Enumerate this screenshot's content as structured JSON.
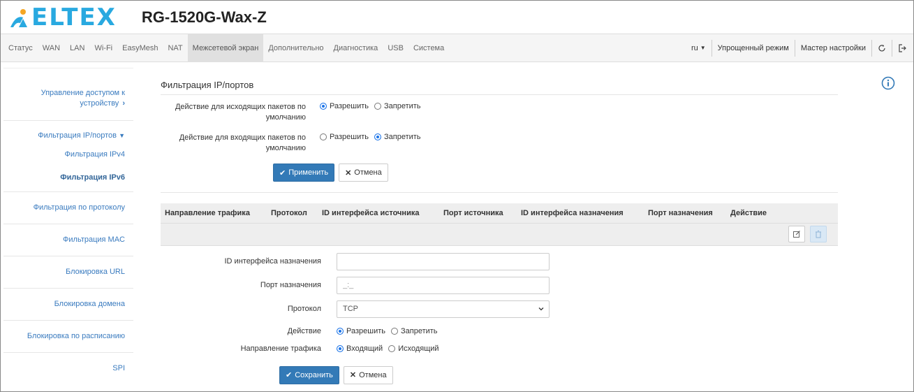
{
  "header": {
    "brand": "ELTEX",
    "model": "RG-1520G-Wax-Z"
  },
  "nav": {
    "items": [
      "Статус",
      "WAN",
      "LAN",
      "Wi-Fi",
      "EasyMesh",
      "NAT",
      "Межсетевой экран",
      "Дополнительно",
      "Диагностика",
      "USB",
      "Система"
    ],
    "active": "Межсетевой экран",
    "language": "ru",
    "simple_mode": "Упрощенный режим",
    "wizard": "Мастер настройки"
  },
  "sidebar": {
    "items": [
      {
        "label": "Управление доступом к устройству",
        "chevron": "›"
      },
      {
        "label": "Фильтрация IP/портов",
        "chevron": "⌄"
      },
      {
        "label": "Фильтрация IPv4"
      },
      {
        "label": "Фильтрация IPv6"
      },
      {
        "label": "Фильтрация по протоколу"
      },
      {
        "label": "Фильтрация MAC"
      },
      {
        "label": "Блокировка URL"
      },
      {
        "label": "Блокировка домена"
      },
      {
        "label": "Блокировка по расписанию"
      },
      {
        "label": "SPI"
      }
    ]
  },
  "main": {
    "title": "Фильтрация IP/портов",
    "outgoing_label": "Действие для исходящих пакетов по умолчанию",
    "incoming_label": "Действие для входящих пакетов по умолчанию",
    "allow": "Разрешить",
    "deny": "Запретить",
    "outgoing_value": "Разрешить",
    "incoming_value": "Запретить",
    "apply": "Применить",
    "cancel": "Отмена"
  },
  "table": {
    "headers": [
      "Направление трафика",
      "Протокол",
      "ID интерфейса источника",
      "Порт источника",
      "ID интерфейса назначения",
      "Порт назначения",
      "Действие"
    ]
  },
  "form": {
    "dest_if_label": "ID интерфейса назначения",
    "dest_if_value": "",
    "dest_port_label": "Порт назначения",
    "dest_port_placeholder": "_:_",
    "protocol_label": "Протокол",
    "protocol_value": "TCP",
    "action_label": "Действие",
    "action_allow": "Разрешить",
    "action_deny": "Запретить",
    "direction_label": "Направление трафика",
    "direction_in": "Входящий",
    "direction_out": "Исходящий",
    "save": "Сохранить",
    "cancel": "Отмена"
  },
  "colors": {
    "brand": "#29a9e0",
    "primary": "#337ab7",
    "link": "#3a7bbf"
  }
}
